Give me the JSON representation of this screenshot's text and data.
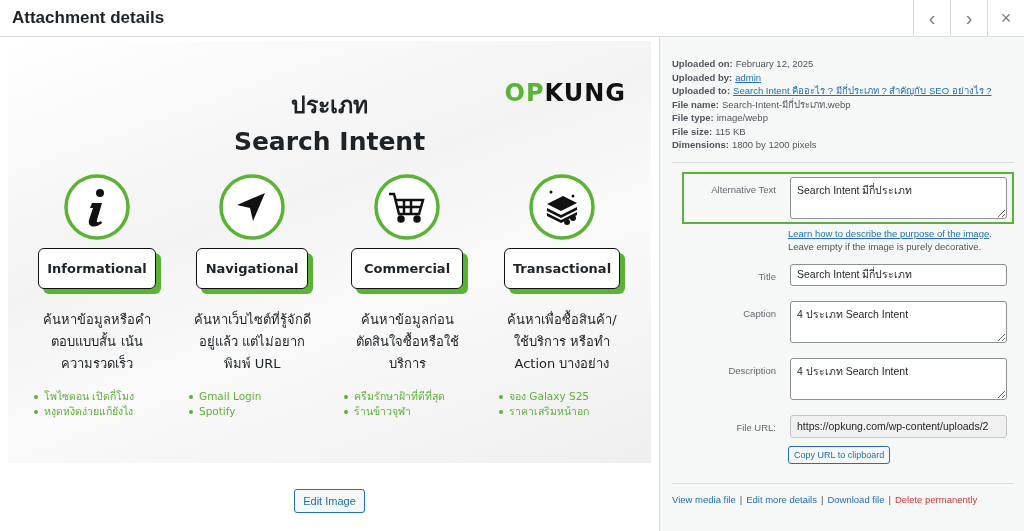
{
  "window": {
    "title": "Attachment details"
  },
  "nav": {
    "prev": "‹",
    "next": "›",
    "close": "×"
  },
  "preview": {
    "heading": "ประเภท",
    "subheading": "Search Intent",
    "logo": {
      "accent": "OP",
      "rest": "KUNG"
    },
    "types": [
      {
        "kind": "info",
        "label": "Informational",
        "lines": [
          "ค้นหาข้อมูลหรือคำ",
          "ตอบแบบสั้น เน้น",
          "ความรวดเร็ว"
        ],
        "examples": [
          "โพไซดอน เปิดกี่โมง",
          "หงุดหงิดง่ายแก้ยังไง"
        ]
      },
      {
        "kind": "navigation",
        "label": "Navigational",
        "lines": [
          "ค้นหาเว็บไซต์ที่รู้จักดี",
          "อยู่แล้ว แต่ไม่อยาก",
          "พิมพ์ URL"
        ],
        "examples": [
          "Gmail Login",
          "Spotify"
        ]
      },
      {
        "kind": "cart",
        "label": "Commercial",
        "lines": [
          "ค้นหาข้อมูลก่อน",
          "ตัดสินใจซื้อหรือใช้",
          "บริการ"
        ],
        "examples": [
          "ครีมรักษาฝ้าที่ดีที่สุด",
          "ร้านข้าวจุฬา"
        ]
      },
      {
        "kind": "money",
        "label": "Transactional",
        "lines": [
          "ค้นหาเพื่อซื้อสินค้า/",
          "ใช้บริการ หรือทำ",
          "Action บางอย่าง"
        ],
        "examples": [
          "จอง Galaxy S25",
          "ราคาเสริมหน้าอก"
        ]
      }
    ]
  },
  "edit_button": "Edit Image",
  "details": [
    {
      "label": "Uploaded on:",
      "value": "February 12, 2025",
      "link": false
    },
    {
      "label": "Uploaded by:",
      "value": "admin",
      "link": true
    },
    {
      "label": "Uploaded to:",
      "value": "Search Intent คืออะไร ? มีกี่ประเภท ? สำคัญกับ SEO อย่างไร ?",
      "link": true
    },
    {
      "label": "File name:",
      "value": "Search-Intent-มีกี่ประเภท.webp",
      "link": false
    },
    {
      "label": "File type:",
      "value": "image/webp",
      "link": false
    },
    {
      "label": "File size:",
      "value": "115 KB",
      "link": false
    },
    {
      "label": "Dimensions:",
      "value": "1800 by 1200 pixels",
      "link": false
    }
  ],
  "fields": [
    {
      "kind": "textarea",
      "label": "Alternative Text",
      "value": "Search Intent มีกี่ประเภท",
      "highlighted": true,
      "help_link": "Learn how to describe the purpose of the image",
      "help_link_end": ".",
      "help_text": "Leave empty if the image is purely decorative."
    },
    {
      "kind": "input",
      "label": "Title",
      "value": "Search Intent มีกี่ประเภท",
      "highlighted": false
    },
    {
      "kind": "textarea",
      "label": "Caption",
      "value": "4 ประเภท Search Intent",
      "highlighted": false
    },
    {
      "kind": "textarea",
      "label": "Description",
      "value": "4 ประเภท Search Intent",
      "highlighted": false
    },
    {
      "kind": "readonly",
      "label": "File URL:",
      "value": "https://opkung.com/wp-content/uploads/2",
      "highlighted": false,
      "button": "Copy URL to clipboard"
    }
  ],
  "actions": [
    {
      "label": "View media file",
      "danger": false
    },
    {
      "label": "Edit more details",
      "danger": false
    },
    {
      "label": "Download file",
      "danger": false
    },
    {
      "label": "Delete permanently",
      "danger": true
    }
  ],
  "action_separator": "|"
}
